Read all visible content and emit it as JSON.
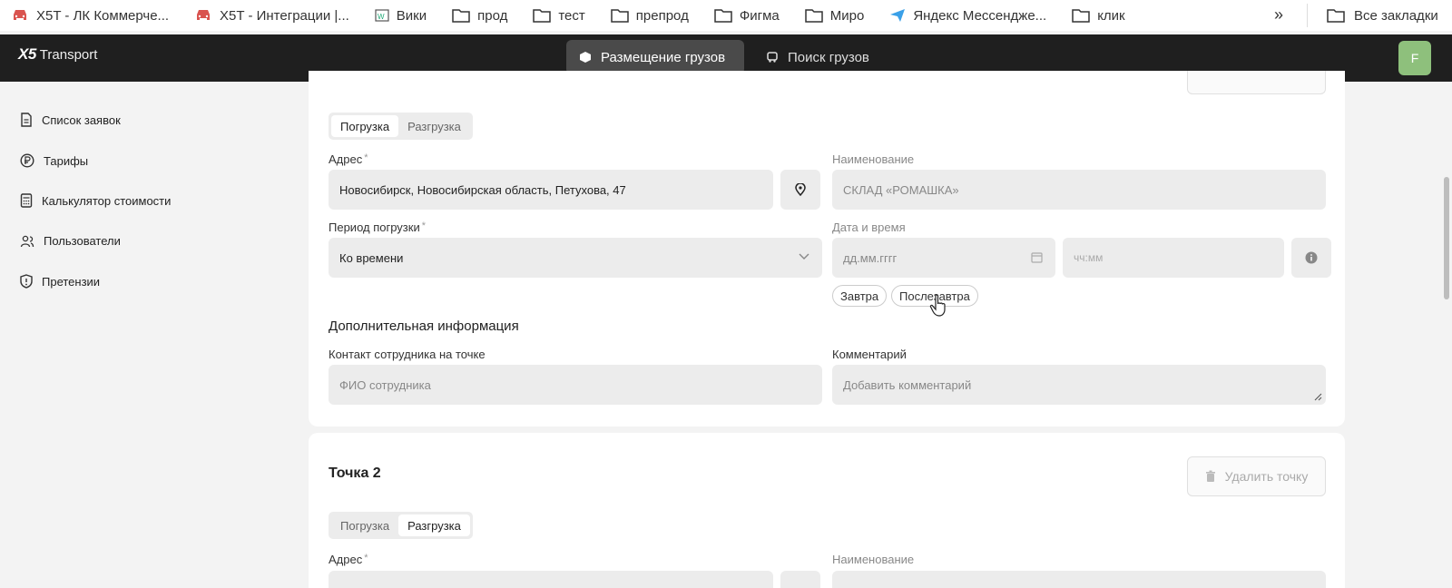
{
  "bookmarks": {
    "items": [
      {
        "label": "X5T - ЛК Коммерче...",
        "icon": "car-icon"
      },
      {
        "label": "X5T - Интеграции |...",
        "icon": "car-icon"
      },
      {
        "label": "Вики",
        "icon": "wiki-icon"
      },
      {
        "label": "прод",
        "icon": "folder-icon"
      },
      {
        "label": "тест",
        "icon": "folder-icon"
      },
      {
        "label": "препрод",
        "icon": "folder-icon"
      },
      {
        "label": "Фигма",
        "icon": "folder-icon"
      },
      {
        "label": "Миро",
        "icon": "folder-icon"
      },
      {
        "label": "Яндекс Мессендже...",
        "icon": "messenger-icon"
      },
      {
        "label": "клик",
        "icon": "folder-icon"
      }
    ],
    "more": "»",
    "all_label": "Все закладки"
  },
  "topnav": {
    "logo_mark": "X5",
    "logo_text": "Transport",
    "tabs": [
      {
        "label": "Размещение грузов",
        "icon": "box-icon"
      },
      {
        "label": "Поиск грузов",
        "icon": "truck-icon"
      }
    ],
    "avatar": "F"
  },
  "sidebar": {
    "items": [
      {
        "label": "Список заявок",
        "icon": "document-icon"
      },
      {
        "label": "Тарифы",
        "icon": "ruble-icon"
      },
      {
        "label": "Калькулятор стоимости",
        "icon": "calculator-icon"
      },
      {
        "label": "Пользователи",
        "icon": "users-icon"
      },
      {
        "label": "Претензии",
        "icon": "shield-icon"
      }
    ]
  },
  "point1": {
    "tabs": [
      "Погрузка",
      "Разгрузка"
    ],
    "active_tab": "Погрузка",
    "address_label": "Адрес",
    "required_mark": "*",
    "address_value": "Новосибирск, Новосибирская область, Петухова, 47",
    "name_label": "Наименование",
    "name_value": "СКЛАД «РОМАШКА»",
    "period_label": "Период погрузки",
    "period_value": "Ко времени",
    "datetime_label": "Дата и время",
    "date_placeholder": "дд.мм.гггг",
    "time_placeholder": "чч:мм",
    "quick_dates": [
      "Завтра",
      "Послезавтра"
    ],
    "additional_title": "Дополнительная информация",
    "contact_label": "Контакт сотрудника на точке",
    "contact_placeholder": "ФИО сотрудника",
    "comment_label": "Комментарий",
    "comment_placeholder": "Добавить комментарий"
  },
  "point2": {
    "title": "Точка 2",
    "delete_label": "Удалить точку",
    "tabs": [
      "Погрузка",
      "Разгрузка"
    ],
    "active_tab": "Разгрузка",
    "address_label": "Адрес",
    "required_mark": "*",
    "name_label": "Наименование"
  }
}
